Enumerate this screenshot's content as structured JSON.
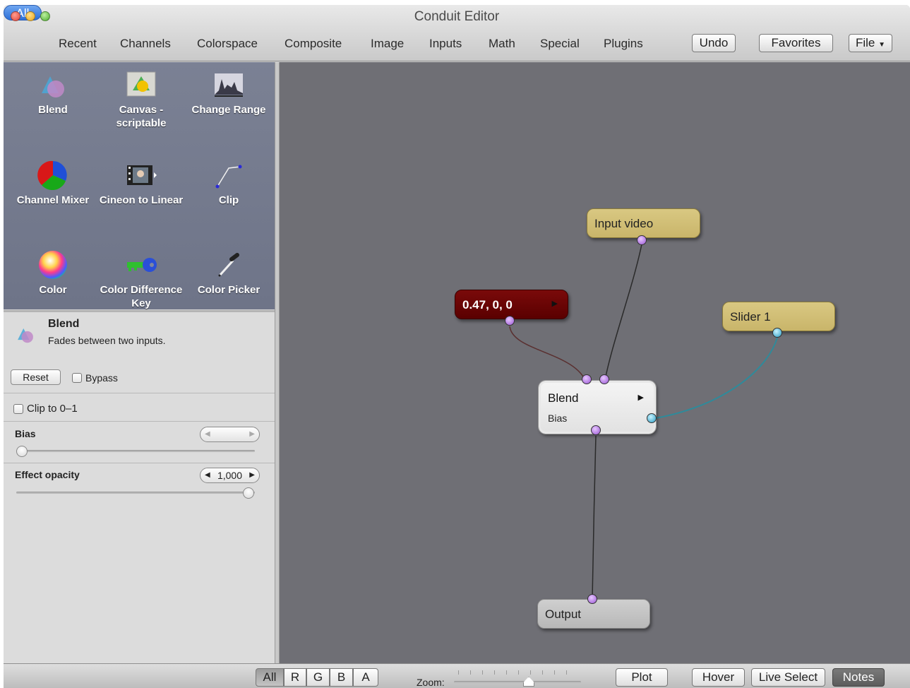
{
  "window": {
    "title": "Conduit Editor"
  },
  "toolbar": {
    "categories": [
      "All",
      "Recent",
      "Channels",
      "Colorspace",
      "Composite",
      "Image",
      "Inputs",
      "Math",
      "Special",
      "Plugins"
    ],
    "selected_category": "All",
    "undo_label": "Undo",
    "favorites_label": "Favorites",
    "file_label": "File"
  },
  "library": {
    "items": [
      {
        "label": "Blend",
        "icon": "blend-icon"
      },
      {
        "label": "Canvas - scriptable",
        "icon": "canvas-icon"
      },
      {
        "label": "Change Range",
        "icon": "histogram-icon"
      },
      {
        "label": "Channel Mixer",
        "icon": "color-wheel-icon"
      },
      {
        "label": "Cineon to Linear",
        "icon": "film-icon"
      },
      {
        "label": "Clip",
        "icon": "curve-icon"
      },
      {
        "label": "Color",
        "icon": "color-sphere-icon"
      },
      {
        "label": "Color Difference Key",
        "icon": "key-icon"
      },
      {
        "label": "Color Picker",
        "icon": "eyedropper-icon"
      }
    ]
  },
  "inspector": {
    "effect_name": "Blend",
    "effect_description": "Fades between two inputs.",
    "reset_label": "Reset",
    "bypass_label": "Bypass",
    "bypass_checked": false,
    "clip_label": "Clip to 0–1",
    "clip_checked": false,
    "bias_label": "Bias",
    "bias_value_level": 0.0,
    "opacity_label": "Effect opacity",
    "opacity_value": "1,000",
    "opacity_level": 1.0
  },
  "graph": {
    "nodes": {
      "color_node": {
        "label": "0.47, 0, 0",
        "color": "#7a0a0a"
      },
      "input_node": {
        "label": "Input video",
        "color": "#d9c882"
      },
      "slider_node": {
        "label": "Slider 1",
        "color": "#d9c882"
      },
      "blend_node": {
        "label": "Blend",
        "param": "Bias",
        "color": "#f4f4f4"
      },
      "output_node": {
        "label": "Output",
        "color": "#cfcfcf"
      }
    }
  },
  "statusbar": {
    "channels": [
      "All",
      "R",
      "G",
      "B",
      "A"
    ],
    "selected_channel": "All",
    "zoom_label": "Zoom:",
    "plot_label": "Plot",
    "hover_label": "Hover",
    "live_select_label": "Live Select",
    "notes_label": "Notes"
  }
}
